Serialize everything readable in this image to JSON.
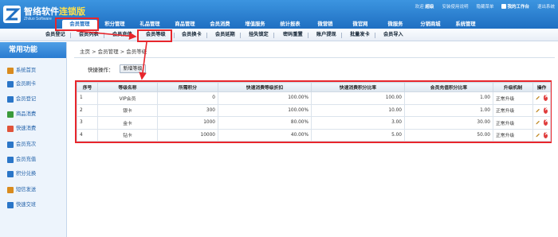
{
  "header": {
    "logo_text": "智络软件",
    "logo_version": "连锁版",
    "logo_sub": "Zhiluo Software",
    "top_links": [
      "欢迎",
      "超级",
      "安装使用说明",
      "隐藏菜单",
      "我的工作台",
      "退出系统"
    ],
    "nav": [
      "会员管理",
      "积分管理",
      "礼品管理",
      "商品管理",
      "会员消费",
      "增值服务",
      "统计报表",
      "微营销",
      "微官网",
      "微服务",
      "分销商城",
      "系统管理"
    ]
  },
  "subnav": {
    "items": [
      "会员登记",
      "会员列表",
      "会员充值",
      "会员等级",
      "会员换卡",
      "会员延期",
      "挂失锁定",
      "密码重置",
      "账户提现",
      "批量发卡",
      "会员导入"
    ]
  },
  "sidebar": {
    "title": "常用功能",
    "items": [
      {
        "label": "系统首页",
        "icon": "home-icon",
        "color": "#d98b1e"
      },
      {
        "label": "会员刷卡",
        "icon": "member-card-icon",
        "color": "#2b76c8"
      },
      {
        "label": "会员登记",
        "icon": "member-register-icon",
        "color": "#2b76c8"
      },
      {
        "label": "商品消费",
        "icon": "goods-consume-icon",
        "color": "#3a9a3a"
      },
      {
        "label": "快速消费",
        "icon": "quick-consume-icon",
        "color": "#e0533a"
      },
      {
        "label": "会员充次",
        "icon": "recharge-times-icon",
        "color": "#2b76c8"
      },
      {
        "label": "会员充值",
        "icon": "recharge-icon",
        "color": "#2b76c8"
      },
      {
        "label": "积分兑换",
        "icon": "points-exchange-icon",
        "color": "#2b76c8"
      },
      {
        "label": "短信发送",
        "icon": "sms-icon",
        "color": "#d98b1e"
      },
      {
        "label": "快速交班",
        "icon": "shift-handover-icon",
        "color": "#2b76c8"
      }
    ]
  },
  "breadcrumb": {
    "parts": [
      "主页",
      ">",
      "会员管理",
      ">",
      "会员等级"
    ]
  },
  "quick": {
    "label": "快捷操作：",
    "button": "新增等级"
  },
  "table": {
    "headers": [
      "序号",
      "等级名称",
      "所需积分",
      "快速消费等级折扣",
      "快速消费积分比率",
      "会员充值积分比率",
      "升级机制",
      "操作"
    ],
    "rows": [
      {
        "no": "1",
        "name": "VIP会员",
        "points": "0",
        "discount": "100.00%",
        "consume_rate": "100.00",
        "recharge_rate": "1.00",
        "mechanism": "正常升级"
      },
      {
        "no": "2",
        "name": "银卡",
        "points": "300",
        "discount": "100.00%",
        "consume_rate": "10.00",
        "recharge_rate": "1.00",
        "mechanism": "正常升级"
      },
      {
        "no": "3",
        "name": "金卡",
        "points": "1000",
        "discount": "80.00%",
        "consume_rate": "3.00",
        "recharge_rate": "30.00",
        "mechanism": "正常升级"
      },
      {
        "no": "4",
        "name": "钻卡",
        "points": "10000",
        "discount": "40.00%",
        "consume_rate": "5.00",
        "recharge_rate": "50.00",
        "mechanism": "正常升级"
      }
    ]
  },
  "colors": {
    "header": "#2a7fd4",
    "highlight": "#e8262c",
    "link": "#1f5fa8"
  }
}
